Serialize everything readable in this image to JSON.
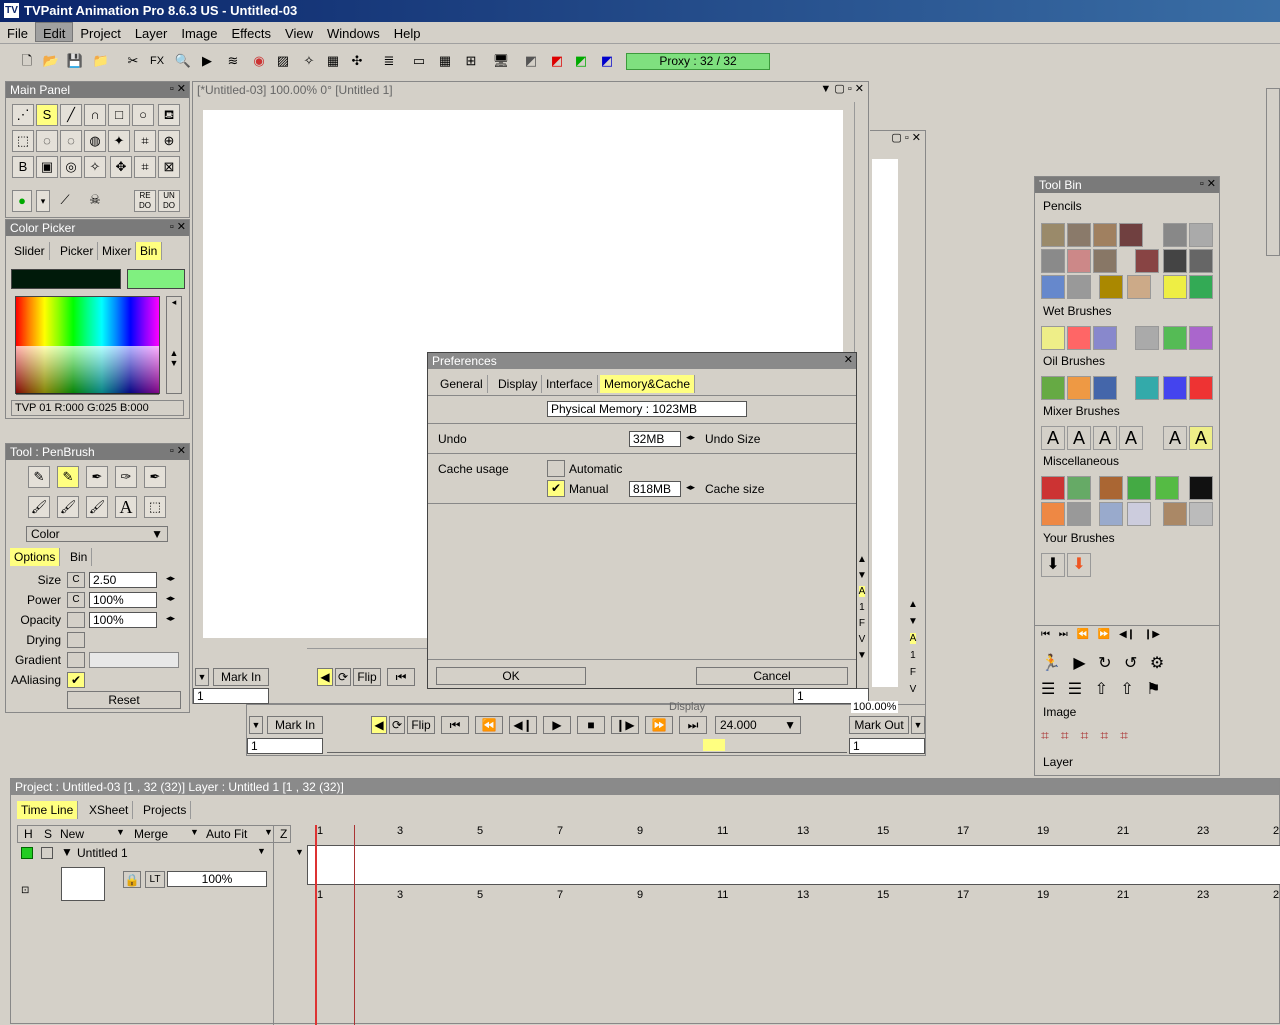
{
  "window": {
    "title": "TVPaint Animation Pro 8.6.3 US - Untitled-03"
  },
  "menu": [
    "File",
    "Edit",
    "Project",
    "Layer",
    "Image",
    "Effects",
    "View",
    "Windows",
    "Help"
  ],
  "toolbar": {
    "proxy": "Proxy : 32 / 32",
    "fx": "FX"
  },
  "main_panel": {
    "title": "Main Panel",
    "redo": "RE DO",
    "undo": "UN DO"
  },
  "color_picker": {
    "title": "Color Picker",
    "tabs": [
      "Slider",
      "Picker",
      "Mixer",
      "Bin"
    ],
    "status": "TVP 01 R:000 G:025 B:000",
    "primary": "#001a0a",
    "secondary": "#80f080"
  },
  "tool_panel": {
    "title": "Tool : PenBrush",
    "mode": "Color",
    "tabs": [
      "Options",
      "Bin"
    ],
    "rows": [
      {
        "label": "Size",
        "value": "2.50"
      },
      {
        "label": "Power",
        "value": "100%"
      },
      {
        "label": "Opacity",
        "value": "100%"
      },
      {
        "label": "Drying",
        "value": ""
      },
      {
        "label": "Gradient",
        "value": ""
      },
      {
        "label": "AAliasing",
        "value": ""
      }
    ],
    "reset": "Reset",
    "text_glyph": "A"
  },
  "doc": {
    "title": "[*Untitled-03]  100.00%  0°  [Untitled 1]",
    "mark_in": "Mark In",
    "flip": "Flip",
    "frame": "1",
    "frame2": "1"
  },
  "doc2": {
    "mark_in": "Mark In",
    "flip": "Flip",
    "fps": "24.000",
    "mark_out": "Mark Out",
    "frame": "1",
    "frame2": "1",
    "zoom": "100.00%",
    "display": "Display"
  },
  "side_letters": [
    "A",
    "1",
    "F",
    "V"
  ],
  "preferences": {
    "title": "Preferences",
    "tabs": [
      "General",
      "Display",
      "Interface",
      "Memory&Cache"
    ],
    "physical_memory": "Physical Memory : 1023MB",
    "undo_label": "Undo",
    "undo_value": "32MB",
    "undo_size": "Undo Size",
    "cache_label": "Cache usage",
    "automatic": "Automatic",
    "manual": "Manual",
    "cache_value": "818MB",
    "cache_size": "Cache size",
    "ok": "OK",
    "cancel": "Cancel"
  },
  "tool_bin": {
    "title": "Tool Bin",
    "sections": [
      "Pencils",
      "Wet Brushes",
      "Oil Brushes",
      "Mixer Brushes",
      "Miscellaneous",
      "Your Brushes"
    ],
    "image": "Image",
    "layer": "Layer"
  },
  "timeline": {
    "header": "Project : Untitled-03 [1 , 32  (32)]      Layer : Untitled 1 [1 , 32  (32)]",
    "tabs": [
      "Time Line",
      "XSheet",
      "Projects"
    ],
    "cols": [
      "H",
      "S",
      "New",
      "Merge",
      "Auto Fit",
      "Z"
    ],
    "layer_name": "Untitled 1",
    "opacity": "100%",
    "lt": "LT",
    "frames": [
      "1",
      "3",
      "5",
      "7",
      "9",
      "11",
      "13",
      "15",
      "17",
      "19",
      "21",
      "23",
      "2"
    ]
  }
}
